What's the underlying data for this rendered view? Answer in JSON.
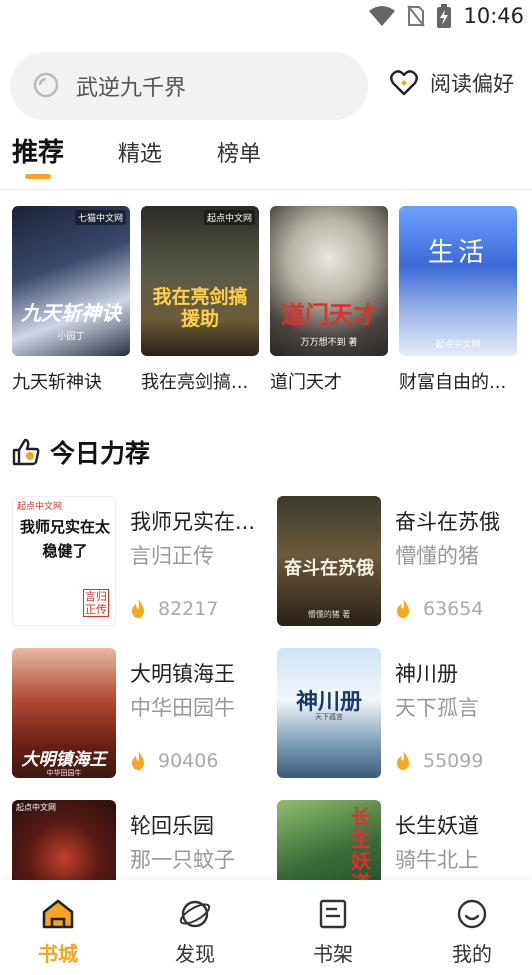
{
  "status_bar": {
    "time": "10:46"
  },
  "search": {
    "placeholder_text": "武逆九千界"
  },
  "header": {
    "preference_label": "阅读偏好"
  },
  "tabs": [
    {
      "label": "推荐",
      "active": true
    },
    {
      "label": "精选",
      "active": false
    },
    {
      "label": "榜单",
      "active": false
    }
  ],
  "featured": [
    {
      "title": "九天斩神诀",
      "cover_text": "九天斩神诀",
      "cover_publisher": "七猫中文网",
      "cover_author": "小园丁"
    },
    {
      "title": "我在亮剑搞...",
      "cover_text": "我在亮剑搞援助",
      "cover_publisher": "起点中文网"
    },
    {
      "title": "道门天才",
      "cover_text": "道门天才",
      "cover_author": "万万想不到 著"
    },
    {
      "title": "财富自由的...",
      "cover_text": "生活",
      "cover_publisher": "起点中文网"
    }
  ],
  "section": {
    "title": "今日力荐"
  },
  "recommended": [
    {
      "title": "我师兄实在...",
      "author": "言归正传",
      "hot": "82217",
      "cover_text": "我师兄实在太稳健了",
      "cover_publisher": "起点中文网",
      "cover_author": "言归正传"
    },
    {
      "title": "奋斗在苏俄",
      "author": "懵懂的猪",
      "hot": "63654",
      "cover_text": "奋斗在苏俄",
      "cover_author": "懵懂的猪 著"
    },
    {
      "title": "大明镇海王",
      "author": "中华田园牛",
      "hot": "90406",
      "cover_text": "大明镇海王",
      "cover_author": "中华田园牛"
    },
    {
      "title": "神川册",
      "author": "天下孤言",
      "hot": "55099",
      "cover_text": "神川册",
      "cover_author": "天下孤言"
    },
    {
      "title": "轮回乐园",
      "author": "那一只蚊子",
      "cover_publisher": "起点中文网"
    },
    {
      "title": "长生妖道",
      "author": "骑牛北上",
      "cover_text": "长生妖道"
    }
  ],
  "bottom_nav": [
    {
      "label": "书城",
      "icon": "home-icon",
      "active": true
    },
    {
      "label": "发现",
      "icon": "planet-icon",
      "active": false
    },
    {
      "label": "书架",
      "icon": "bookshelf-icon",
      "active": false
    },
    {
      "label": "我的",
      "icon": "smile-face-icon",
      "active": false
    }
  ],
  "colors": {
    "accent": "#f5a623",
    "search_bg": "#f2f2f2",
    "muted_text": "#999999"
  }
}
